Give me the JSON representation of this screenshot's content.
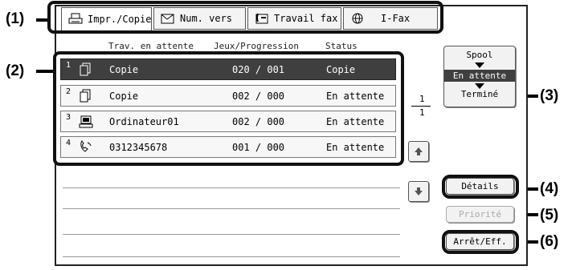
{
  "callouts": {
    "c1": "(1)",
    "c2": "(2)",
    "c3": "(3)",
    "c4": "(4)",
    "c5": "(5)",
    "c6": "(6)"
  },
  "tabs": [
    {
      "label": "Impr./Copie",
      "icon": "printer-icon",
      "active": true
    },
    {
      "label": "Num. vers",
      "icon": "scan-envelope-icon",
      "active": false
    },
    {
      "label": "Travail fax",
      "icon": "fax-phone-icon",
      "active": false
    },
    {
      "label": "I-Fax",
      "icon": "globe-icon",
      "active": false
    }
  ],
  "columns": {
    "queue": "Trav. en attente",
    "sets": "Jeux/Progression",
    "status": "Status"
  },
  "jobs": [
    {
      "num": "1",
      "icon": "copy-icon",
      "name": "Copie",
      "progress": "020 / 001",
      "status": "Copie",
      "selected": true
    },
    {
      "num": "2",
      "icon": "copy-icon",
      "name": "Copie",
      "progress": "002 / 000",
      "status": "En attente",
      "selected": false
    },
    {
      "num": "3",
      "icon": "computer-icon",
      "name": "Ordinateur01",
      "progress": "002 / 000",
      "status": "En attente",
      "selected": false
    },
    {
      "num": "4",
      "icon": "fax-icon",
      "name": "0312345678",
      "progress": "001 / 000",
      "status": "En attente",
      "selected": false
    }
  ],
  "pager": {
    "current": "1",
    "total": "1"
  },
  "spool": {
    "spool": "Spool",
    "waiting": "En attente",
    "done": "Terminé"
  },
  "buttons": {
    "details": "Détails",
    "priority": "Priorité",
    "stop_delete": "Arrêt/Eff."
  }
}
